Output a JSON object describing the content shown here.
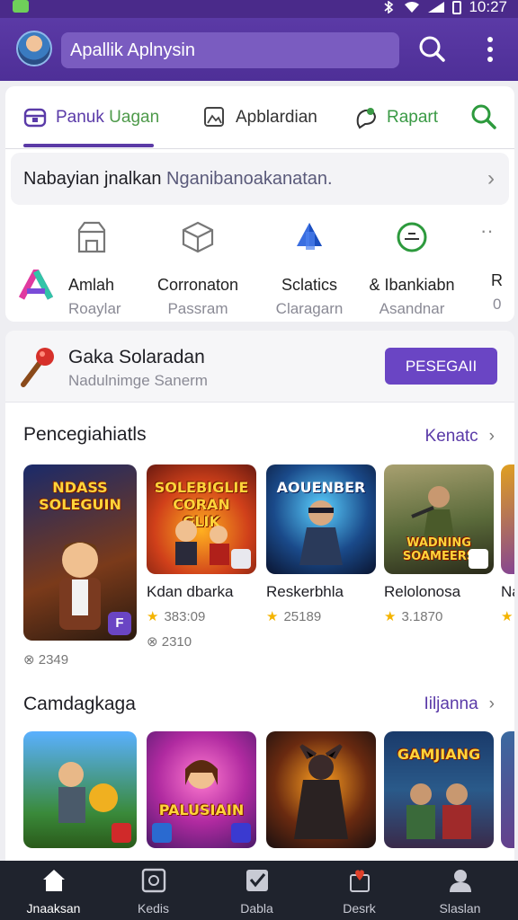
{
  "status_bar": {
    "time": "10:27"
  },
  "app_bar": {
    "title": "Apallik Aplnysin"
  },
  "tabs": [
    {
      "label_a": "Panuk",
      "label_b": "Uagan"
    },
    {
      "label": "Apblardian"
    },
    {
      "label": "Rapart"
    }
  ],
  "banner": {
    "title": "Nabayian jnalkan",
    "subtitle": "Nganibanoakanatan."
  },
  "categories": [
    {
      "name": "Amlah",
      "sub": "Roaylar"
    },
    {
      "name": "Corronaton",
      "sub": "Passram"
    },
    {
      "name": "Sclatics",
      "sub": "Claragarn"
    },
    {
      "name": "& Ibankiabn",
      "sub": "Asandnar"
    },
    {
      "name": "R",
      "sub": "0"
    }
  ],
  "promo": {
    "title": "Gaka Solaradan",
    "subtitle": "Nadulnimge Sanerm",
    "button": "PESEGAII"
  },
  "section1": {
    "title": "Pencegiahiatls",
    "link": "Kenatc",
    "games": [
      {
        "thumb_title": "NDASS SOLEGUIN",
        "name": "",
        "rating": "",
        "extra": "2349"
      },
      {
        "thumb_title": "SOLEBIGLIE CORAN GLIK",
        "name": "Kdan dbarka",
        "rating": "383:09",
        "extra": "2310"
      },
      {
        "thumb_title": "AOUENBER",
        "name": "Reskerbhla",
        "rating": "25189",
        "extra": ""
      },
      {
        "thumb_title": "WADNING SOAMEERS",
        "name": "Relolonosa",
        "rating": "3.1870",
        "extra": ""
      },
      {
        "thumb_title": "",
        "name": "Na",
        "rating": "",
        "extra": ""
      }
    ]
  },
  "section2": {
    "title": "Camdagkaga",
    "link": "Iiljanna",
    "games": [
      {
        "thumb_title": ""
      },
      {
        "thumb_title": "PALUSIAIN"
      },
      {
        "thumb_title": ""
      },
      {
        "thumb_title": "GAMJIANG"
      },
      {
        "thumb_title": ""
      }
    ]
  },
  "bottom_nav": [
    {
      "label": "Jnaaksan"
    },
    {
      "label": "Kedis"
    },
    {
      "label": "Dabla"
    },
    {
      "label": "Desrk"
    },
    {
      "label": "Slaslan"
    }
  ]
}
